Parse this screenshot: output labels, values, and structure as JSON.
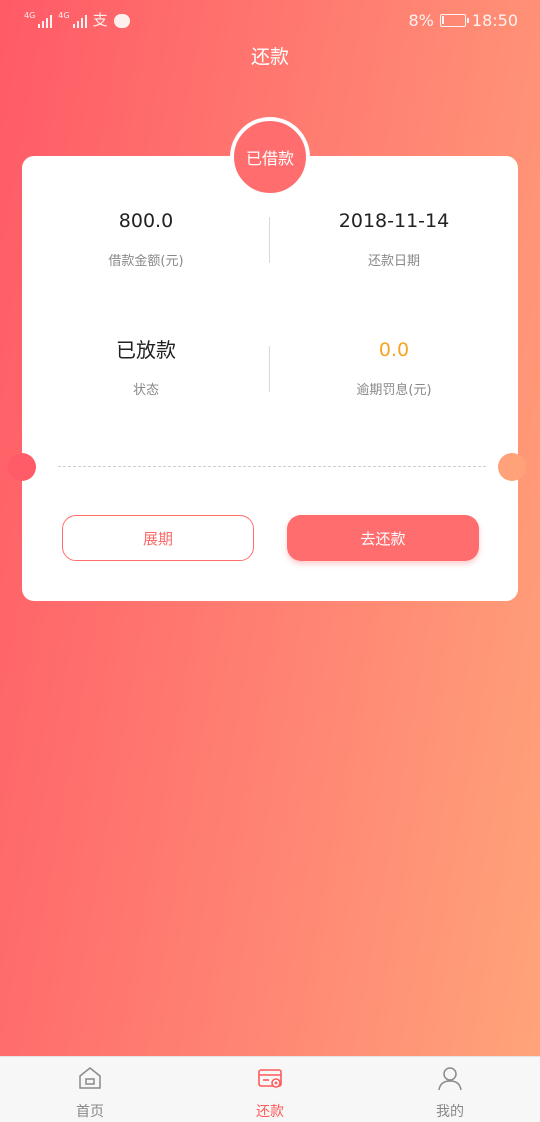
{
  "status_bar": {
    "net1": "4G",
    "net2": "4G",
    "battery_level": "8%",
    "battery_fraction": 0.08,
    "time": "18:50"
  },
  "header": {
    "title": "还款"
  },
  "card": {
    "badge": "已借款",
    "loan_amount_value": "800.0",
    "loan_amount_label": "借款金额(元)",
    "repay_date_value": "2018-11-14",
    "repay_date_label": "还款日期",
    "status_value": "已放款",
    "status_label": "状态",
    "penalty_value": "0.0",
    "penalty_label": "逾期罚息(元)",
    "extend_button": "展期",
    "repay_button": "去还款"
  },
  "tabbar": {
    "items": [
      {
        "label": "首页",
        "icon": "home-icon",
        "active": false
      },
      {
        "label": "还款",
        "icon": "repay-card-icon",
        "active": true
      },
      {
        "label": "我的",
        "icon": "user-icon",
        "active": false
      }
    ]
  },
  "colors": {
    "accent": "#ff6d6f",
    "penalty": "#f5a623",
    "active_tab": "#ff5a5a"
  }
}
